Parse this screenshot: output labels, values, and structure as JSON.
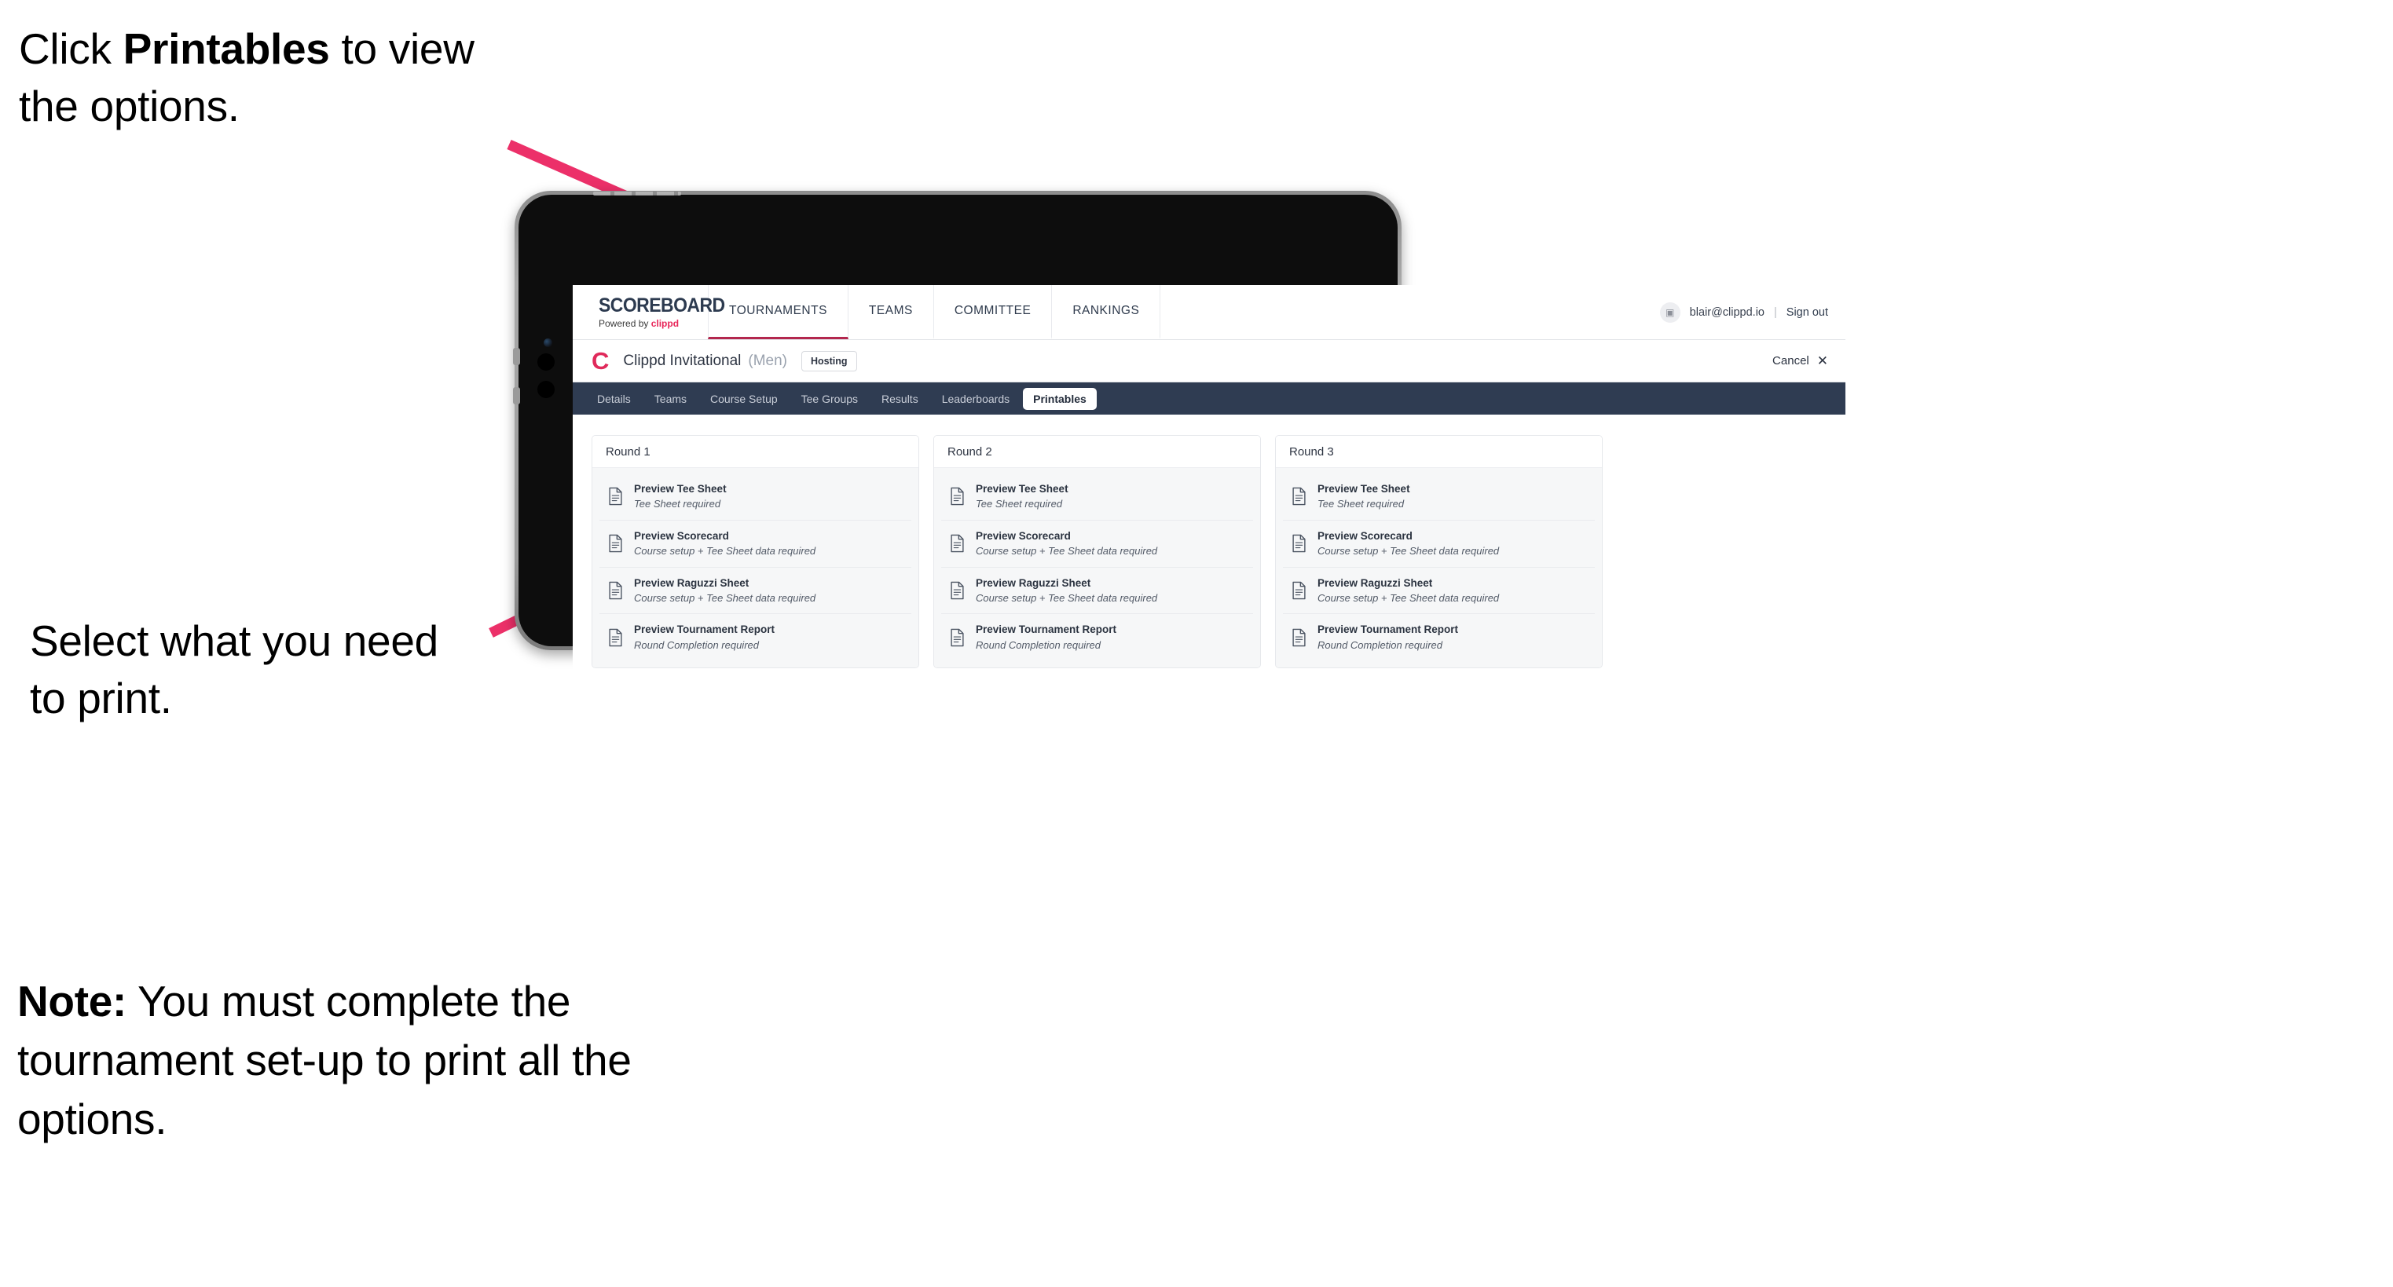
{
  "annotations": {
    "top": {
      "pre": "Click ",
      "bold": "Printables",
      "post": " to view the options."
    },
    "middle": "Select what you need to print.",
    "note": {
      "bold": "Note:",
      "text": " You must complete the tournament set-up to print all the options."
    }
  },
  "colors": {
    "arrow_pink": "#ec3069",
    "navbar_navy": "#2f3c52",
    "brand_pink": "#e8275a",
    "accent_underline": "#b3274e"
  },
  "app": {
    "brand": {
      "title": "SCOREBOARD",
      "powered_prefix": "Powered by ",
      "powered_name": "clippd"
    },
    "top_nav": [
      {
        "label": "TOURNAMENTS",
        "active": true
      },
      {
        "label": "TEAMS",
        "active": false
      },
      {
        "label": "COMMITTEE",
        "active": false
      },
      {
        "label": "RANKINGS",
        "active": false
      }
    ],
    "account": {
      "avatar_icon": "user-avatar-icon",
      "email": "blair@clippd.io",
      "separator": "|",
      "sign_out": "Sign out"
    },
    "tournament": {
      "logo_letter": "C",
      "name": "Clippd Invitational",
      "gender": "(Men)",
      "status_badge": "Hosting",
      "cancel_label": "Cancel",
      "cancel_icon": "close-icon"
    },
    "sub_tabs": [
      {
        "label": "Details",
        "active": false
      },
      {
        "label": "Teams",
        "active": false
      },
      {
        "label": "Course Setup",
        "active": false
      },
      {
        "label": "Tee Groups",
        "active": false
      },
      {
        "label": "Results",
        "active": false
      },
      {
        "label": "Leaderboards",
        "active": false
      },
      {
        "label": "Printables",
        "active": true
      }
    ],
    "rounds": [
      {
        "header": "Round 1",
        "items": [
          {
            "icon": "document-icon",
            "title": "Preview Tee Sheet",
            "subtitle": "Tee Sheet required"
          },
          {
            "icon": "document-icon",
            "title": "Preview Scorecard",
            "subtitle": "Course setup + Tee Sheet data required"
          },
          {
            "icon": "document-icon",
            "title": "Preview Raguzzi Sheet",
            "subtitle": "Course setup + Tee Sheet data required"
          },
          {
            "icon": "document-icon",
            "title": "Preview Tournament Report",
            "subtitle": "Round Completion required"
          }
        ]
      },
      {
        "header": "Round 2",
        "items": [
          {
            "icon": "document-icon",
            "title": "Preview Tee Sheet",
            "subtitle": "Tee Sheet required"
          },
          {
            "icon": "document-icon",
            "title": "Preview Scorecard",
            "subtitle": "Course setup + Tee Sheet data required"
          },
          {
            "icon": "document-icon",
            "title": "Preview Raguzzi Sheet",
            "subtitle": "Course setup + Tee Sheet data required"
          },
          {
            "icon": "document-icon",
            "title": "Preview Tournament Report",
            "subtitle": "Round Completion required"
          }
        ]
      },
      {
        "header": "Round 3",
        "items": [
          {
            "icon": "document-icon",
            "title": "Preview Tee Sheet",
            "subtitle": "Tee Sheet required"
          },
          {
            "icon": "document-icon",
            "title": "Preview Scorecard",
            "subtitle": "Course setup + Tee Sheet data required"
          },
          {
            "icon": "document-icon",
            "title": "Preview Raguzzi Sheet",
            "subtitle": "Course setup + Tee Sheet data required"
          },
          {
            "icon": "document-icon",
            "title": "Preview Tournament Report",
            "subtitle": "Round Completion required"
          }
        ]
      }
    ]
  }
}
